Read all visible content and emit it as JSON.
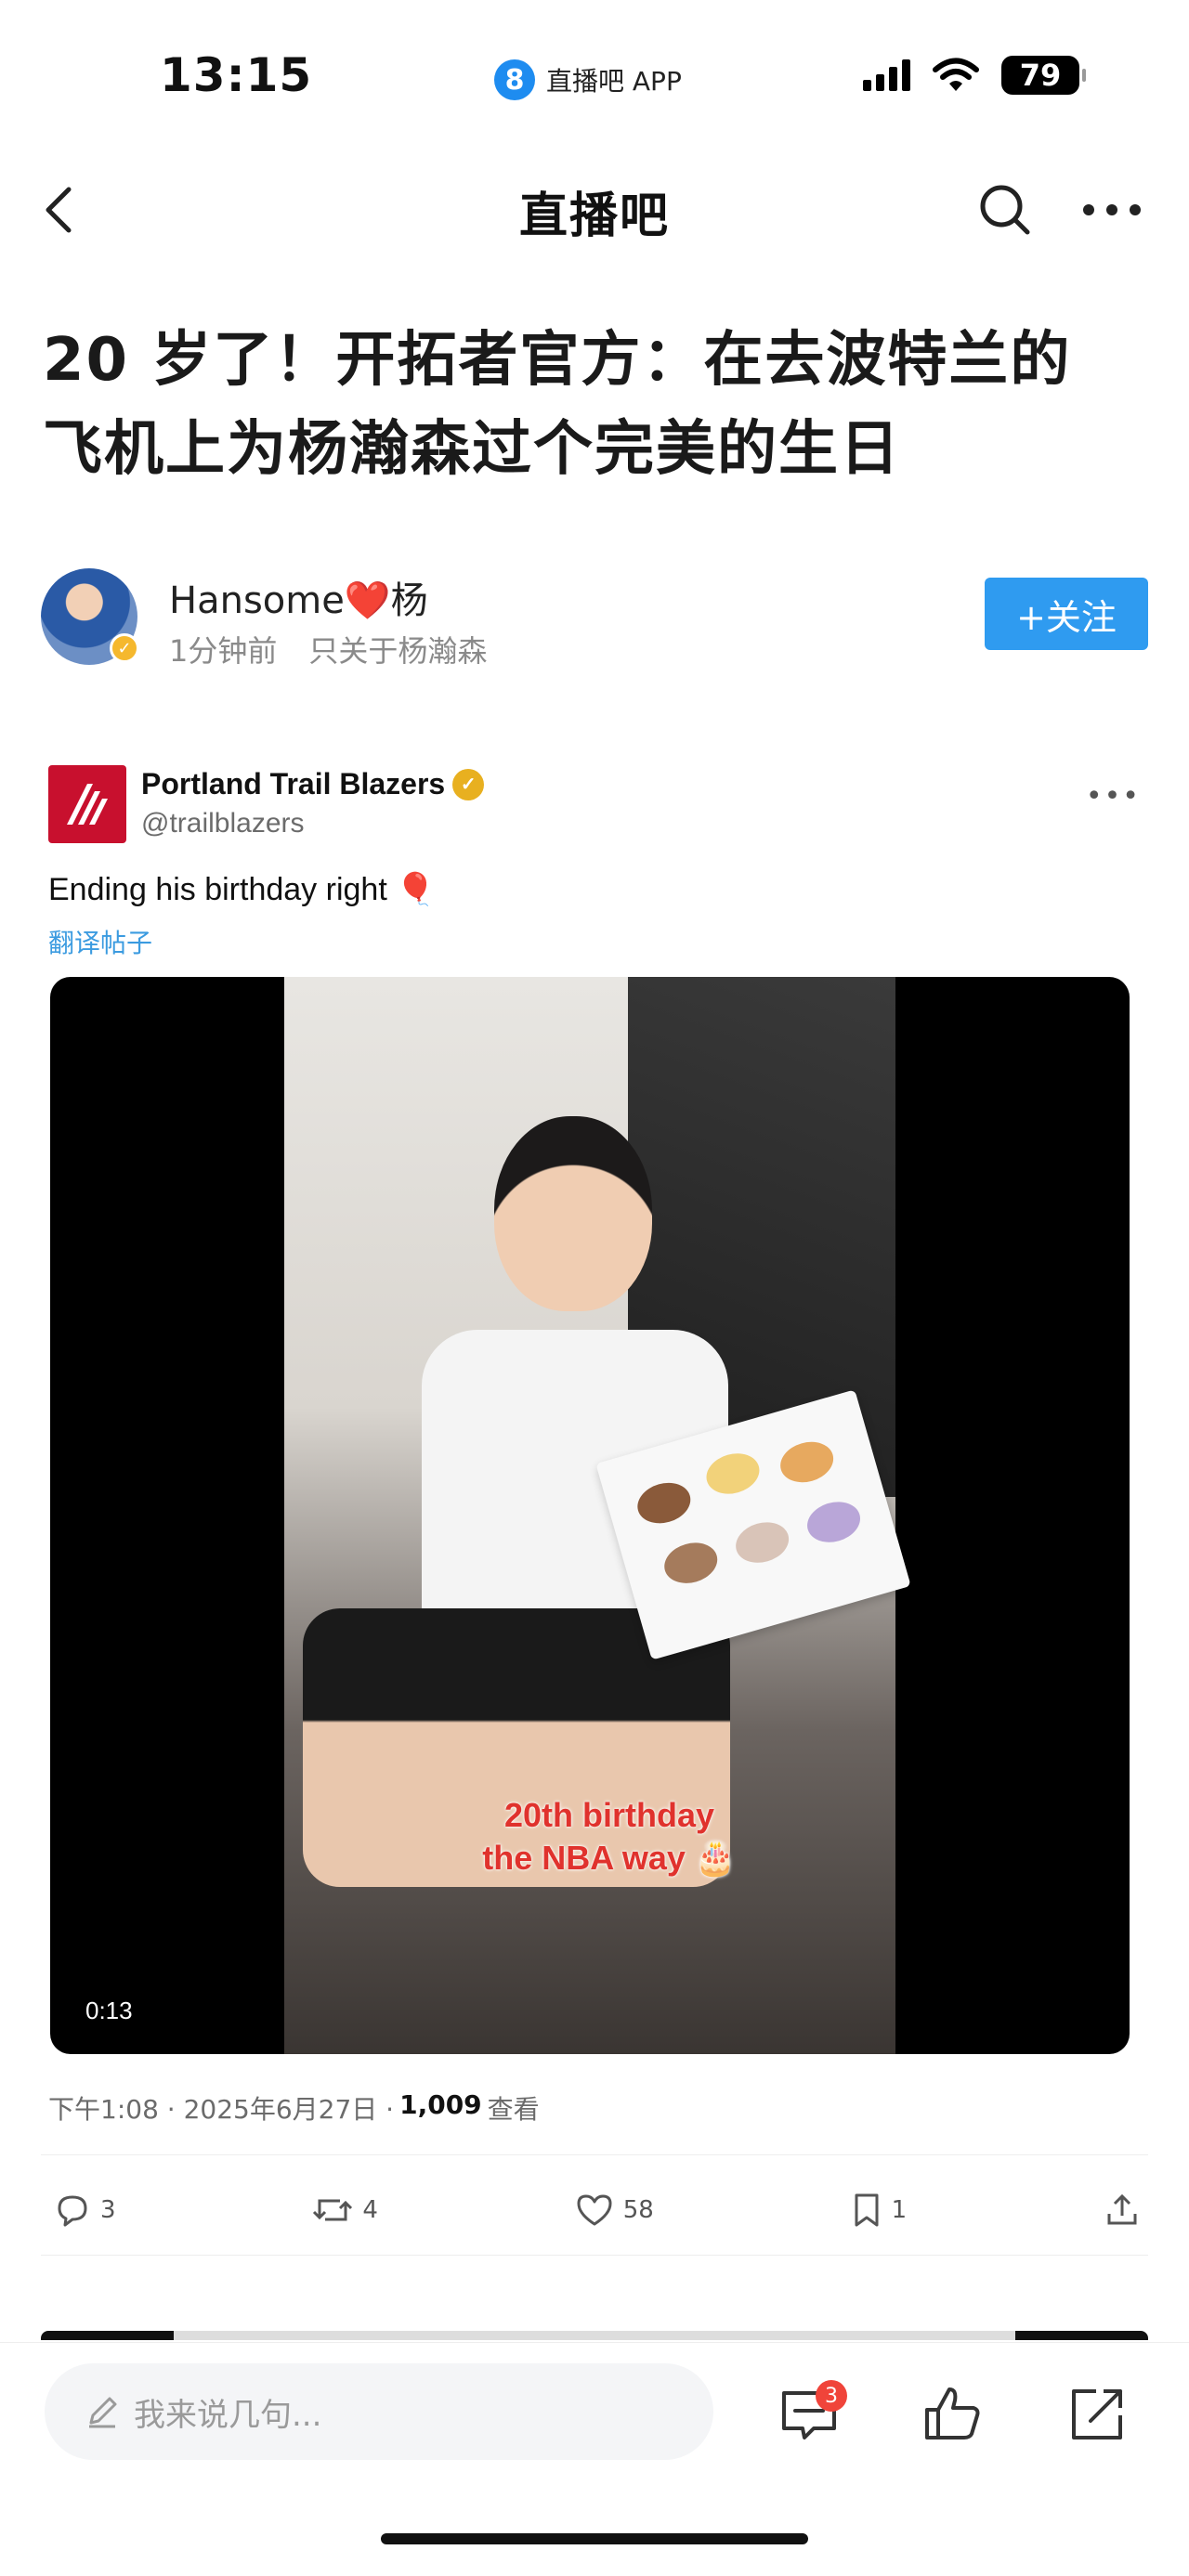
{
  "status_bar": {
    "time": "13:15",
    "app_logo": "8",
    "app_name": "直播吧 APP",
    "battery": "79"
  },
  "nav": {
    "title": "直播吧"
  },
  "article": {
    "title_line1": "20 岁了！开拓者官方：在去波特兰的",
    "title_line2": "飞机上为杨瀚森过个完美的生日"
  },
  "author": {
    "name": "Hansome❤️杨",
    "time": "1分钟前",
    "tagline": "只关于杨瀚森",
    "follow_label": "+关注"
  },
  "tweet": {
    "name": "Portland Trail Blazers",
    "handle": "@trailblazers",
    "text": "Ending his birthday right 🎈",
    "translate": "翻译帖子",
    "video_caption_line1": "20th birthday",
    "video_caption_line2": "the NBA way 🎂",
    "video_duration": "0:13",
    "meta_time": "下午1:08 · 2025年6月27日 ·",
    "meta_views": "1,009",
    "meta_views_label": "查看",
    "replies": "3",
    "retweets": "4",
    "likes": "58",
    "bookmarks": "1"
  },
  "bottom_bar": {
    "comment_placeholder": "我来说几句...",
    "comment_badge": "3"
  },
  "icons": [
    "back-icon",
    "search-icon",
    "more-icon",
    "pencil-icon",
    "comment-icon",
    "thumbs-up-icon",
    "share-icon",
    "reply-icon",
    "retweet-icon",
    "heart-icon",
    "bookmark-icon",
    "upload-icon"
  ],
  "colors": {
    "follow_button": "#2f9bf0",
    "translate_link": "#3b9be0",
    "blazers_red": "#c8102e",
    "badge_red": "#f0443a"
  }
}
